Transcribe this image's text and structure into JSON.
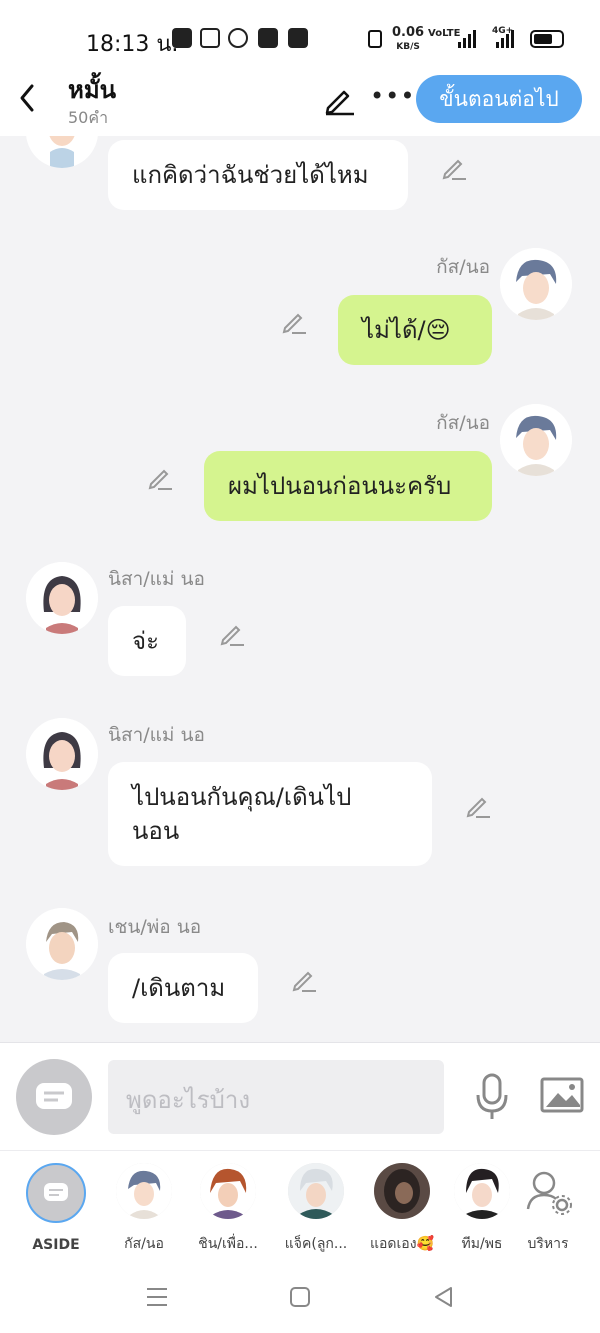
{
  "status_bar": {
    "time": "18:13 น.",
    "net_speed": "0.06",
    "net_unit": "KB/S",
    "volte": "VoLTE",
    "network": "4G+"
  },
  "header": {
    "title": "หมั้น",
    "word_count": "50คำ",
    "next_button": "ขั้นตอนต่อไป"
  },
  "messages": [
    {
      "side": "left",
      "speaker": "",
      "text": "แกคิดว่าฉันช่วยได้ไหม"
    },
    {
      "side": "right",
      "speaker": "กัส/นอ",
      "text": "ไม่ได้/😔"
    },
    {
      "side": "right",
      "speaker": "กัส/นอ",
      "text": "ผมไปนอนก่อนนะครับ"
    },
    {
      "side": "left",
      "speaker": "นิสา/แม่ นอ",
      "text": "จ่ะ"
    },
    {
      "side": "left",
      "speaker": "นิสา/แม่ นอ",
      "text": "ไปนอนกันคุณ/เดินไป",
      "text_line2": "นอน"
    },
    {
      "side": "left",
      "speaker": "เชน/พ่อ นอ",
      "text": "/เดินตาม"
    }
  ],
  "input": {
    "placeholder": "พูดอะไรบ้าง"
  },
  "characters": [
    {
      "label": "ASIDE",
      "active": true
    },
    {
      "label": "กัส/นอ"
    },
    {
      "label": "ชิน/เพื่อ..."
    },
    {
      "label": "แจ็ค(ลูก..."
    },
    {
      "label": "แอดเอง🥰"
    },
    {
      "label": "ทีม/พธ"
    },
    {
      "label": "บริหาร"
    }
  ],
  "colors": {
    "accent": "#5aa7f0",
    "my_bubble": "#d5f48f",
    "other_bubble": "#ffffff",
    "background": "#f3f3f5"
  }
}
